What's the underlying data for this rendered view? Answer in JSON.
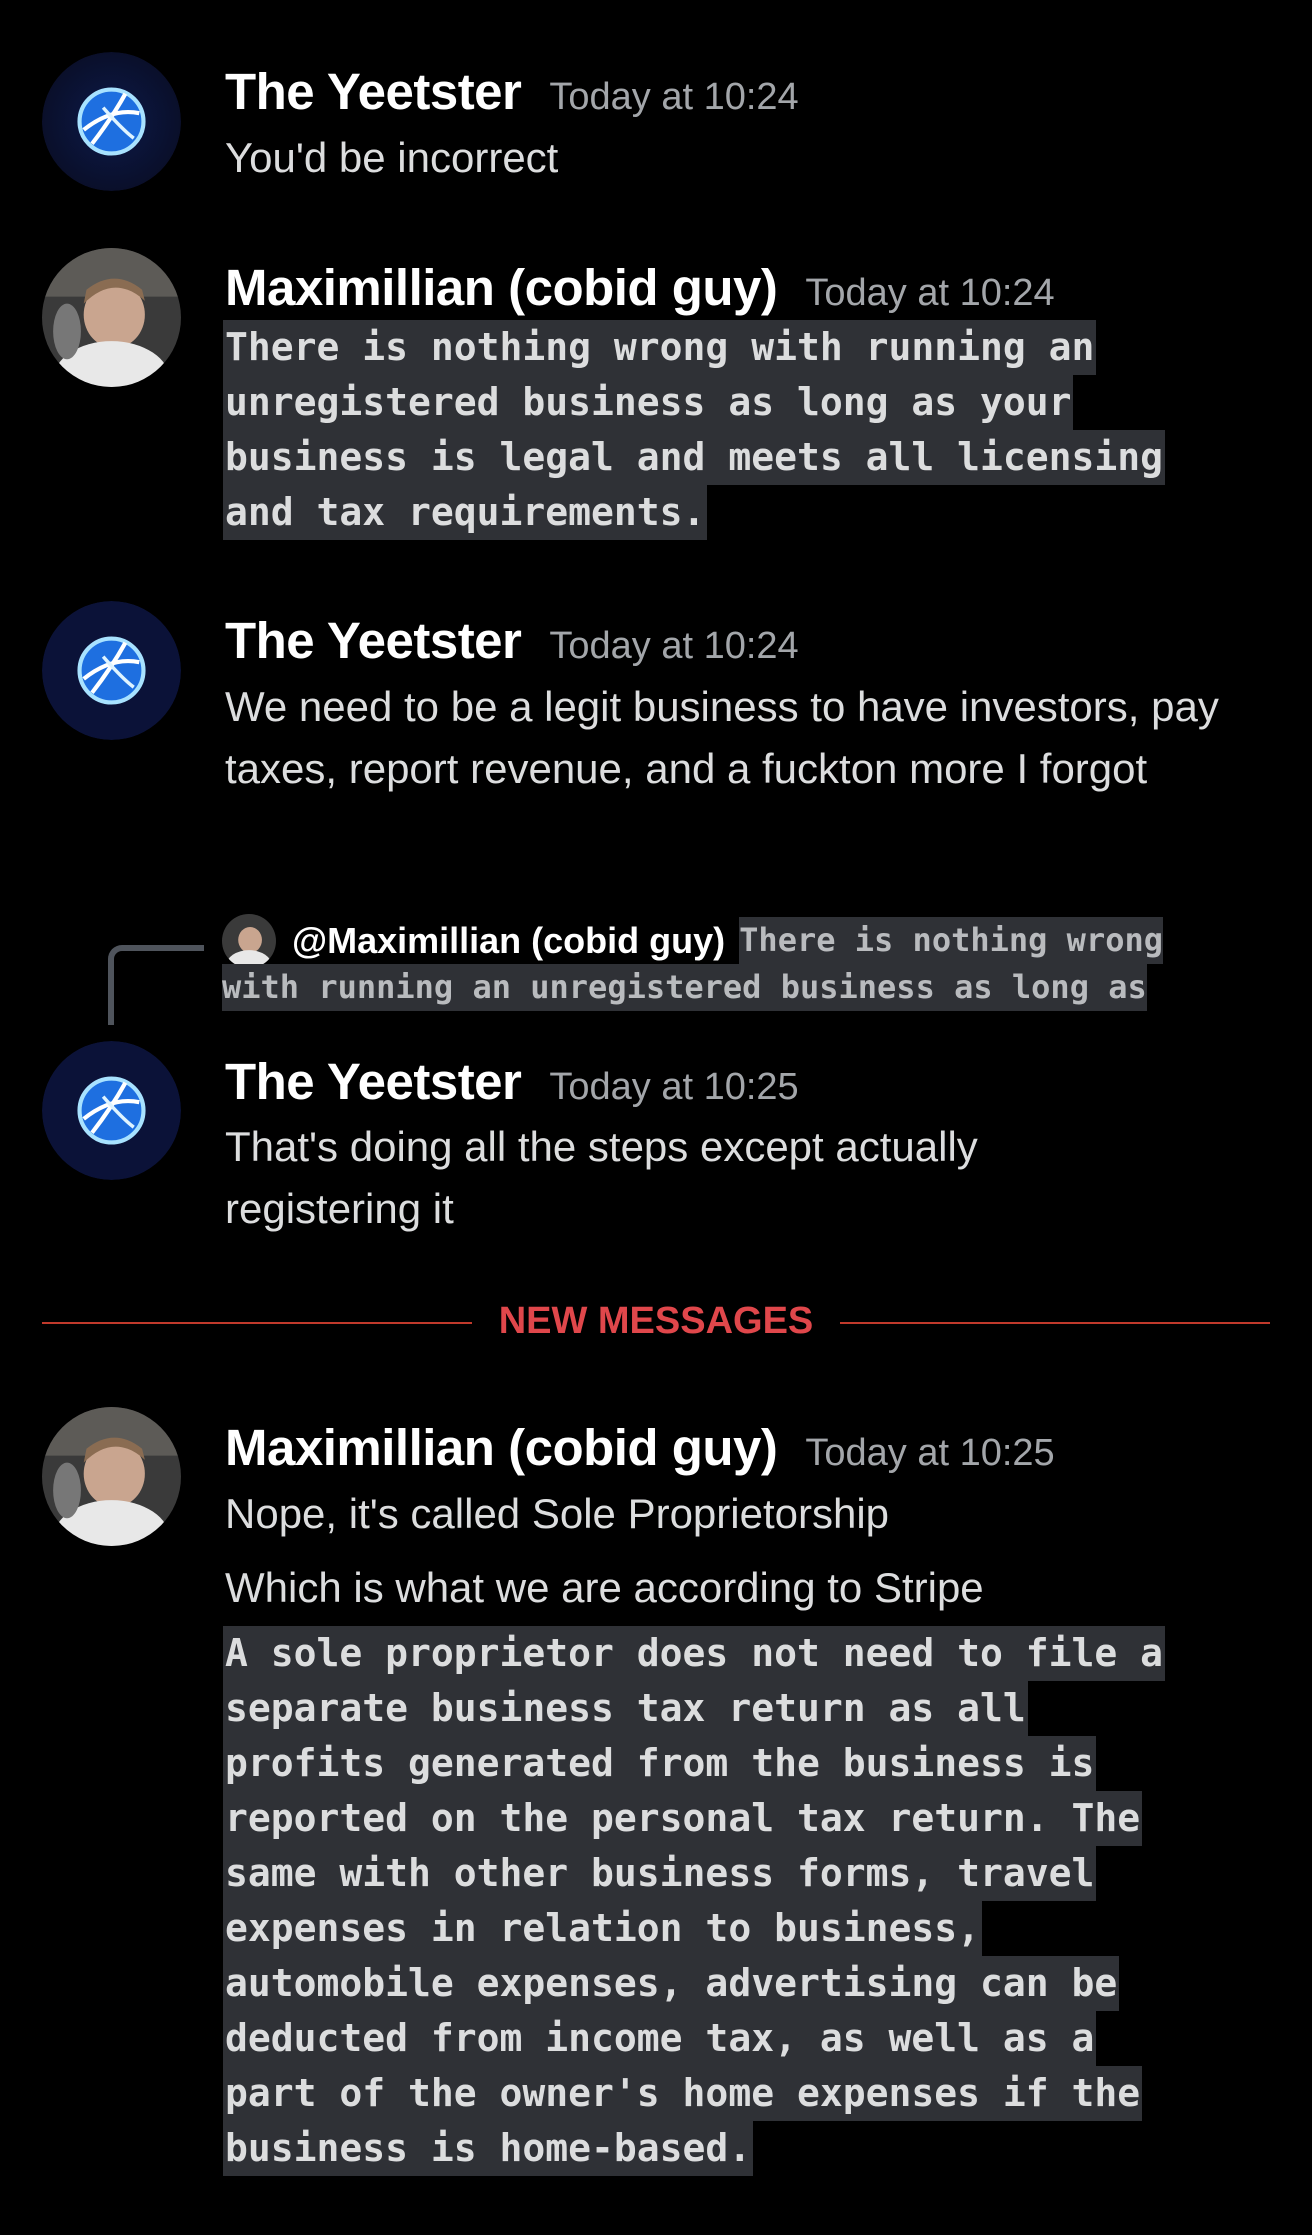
{
  "messages": [
    {
      "author": "The Yeetster",
      "timestamp": "Today at 10:24",
      "text": "You'd be incorrect"
    },
    {
      "author": "Maximillian (cobid guy)",
      "timestamp": "Today at 10:24",
      "code_lines": [
        "There is nothing wrong with running an",
        "unregistered business as long as your",
        "business is legal and meets all licensing",
        "and tax requirements."
      ]
    },
    {
      "author": "The Yeetster",
      "timestamp": "Today at 10:24",
      "text": "We need to be a legit business to have investors, pay taxes, report revenue, and a fuckton more I forgot"
    },
    {
      "author": "The Yeetster",
      "timestamp": "Today at 10:25",
      "reply": {
        "author": "@Maximillian (cobid guy)",
        "preview_line1": "There is nothing wrong",
        "preview_line2": "with running an unregistered business as long as"
      },
      "text": "That's doing all the steps except actually registering it"
    },
    {
      "author": "Maximillian (cobid guy)",
      "timestamp": "Today at 10:25",
      "text": "Nope, it's called Sole Proprietorship",
      "text2": "Which is what we are according to Stripe",
      "code_lines": [
        "A sole proprietor does not need to file a",
        "separate business tax return as all",
        "profits generated from the business is",
        "reported on the personal tax return. The",
        "same with other business forms, travel",
        "expenses in relation to business,",
        "automobile expenses, advertising can be",
        "deducted from income tax, as well as a",
        "part of the owner's home expenses if the",
        "business is home-based."
      ]
    }
  ],
  "divider": {
    "label": "NEW MESSAGES",
    "color": "#e0474b"
  },
  "colors": {
    "background": "#000000",
    "code_bg": "#2f3136",
    "timestamp": "#a3a6aa"
  },
  "icons": {
    "yeetster_avatar": "blue-globe-avatar",
    "maximillian_avatar": "person-photo-avatar"
  }
}
